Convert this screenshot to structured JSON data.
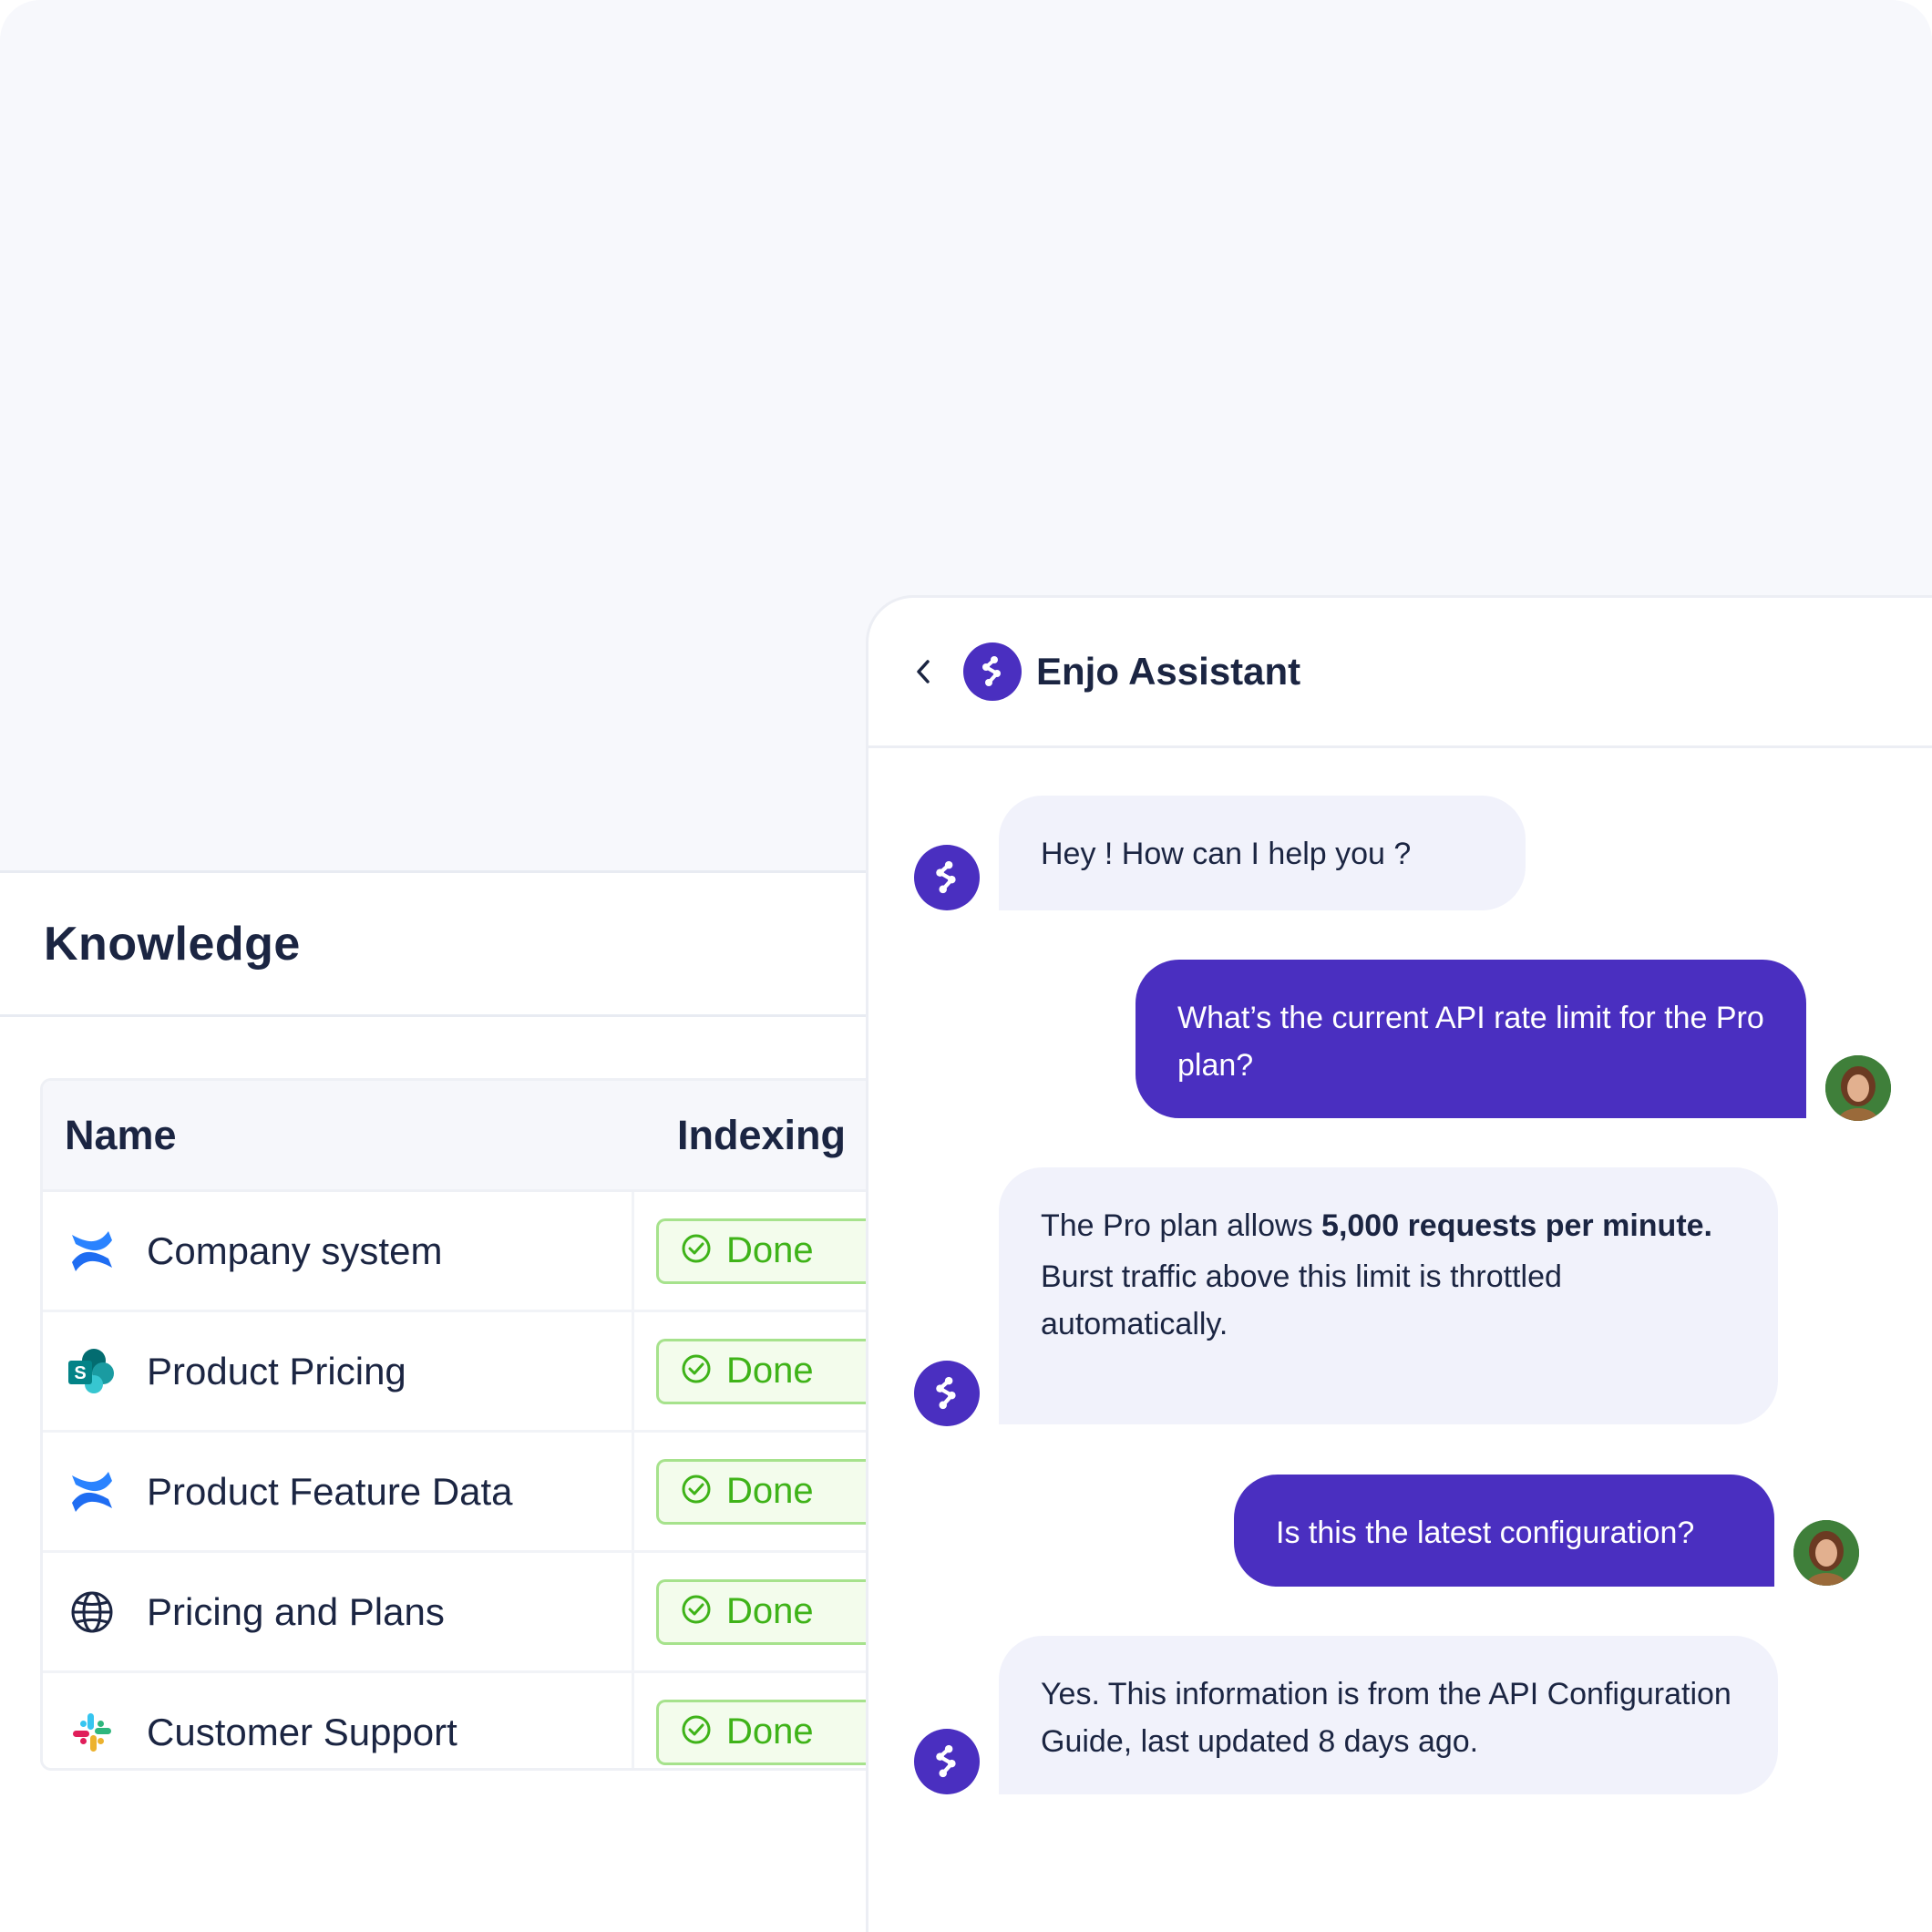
{
  "knowledge": {
    "title": "Knowledge",
    "columns": {
      "name": "Name",
      "indexing": "Indexing"
    },
    "rows": [
      {
        "name": "Company system",
        "icon": "confluence-icon",
        "status": "Done"
      },
      {
        "name": "Product Pricing",
        "icon": "sharepoint-icon",
        "status": "Done"
      },
      {
        "name": "Product Feature Data",
        "icon": "confluence-icon",
        "status": "Done"
      },
      {
        "name": "Pricing and Plans",
        "icon": "globe-icon",
        "status": "Done"
      },
      {
        "name": "Customer Support",
        "icon": "slack-icon",
        "status": "Done"
      }
    ]
  },
  "chat": {
    "title": "Enjo Assistant",
    "messages": [
      {
        "from": "bot",
        "text": "Hey ! How can I help you ?"
      },
      {
        "from": "user",
        "text": "What’s the current API rate limit for the Pro plan?"
      },
      {
        "from": "bot",
        "text_before": "The Pro plan allows ",
        "text_bold": "5,000 requests per minute.",
        "text_after": "Burst traffic above this limit is throttled automatically."
      },
      {
        "from": "user",
        "text": "Is this the latest configuration?"
      },
      {
        "from": "bot",
        "text": "Yes. This information is from the API Configuration Guide, last updated 8 days ago."
      }
    ]
  },
  "colors": {
    "brand": "#4a2fc0",
    "success": "#3fb319",
    "text": "#1b2542",
    "bot_bubble": "#f1f2fb"
  }
}
